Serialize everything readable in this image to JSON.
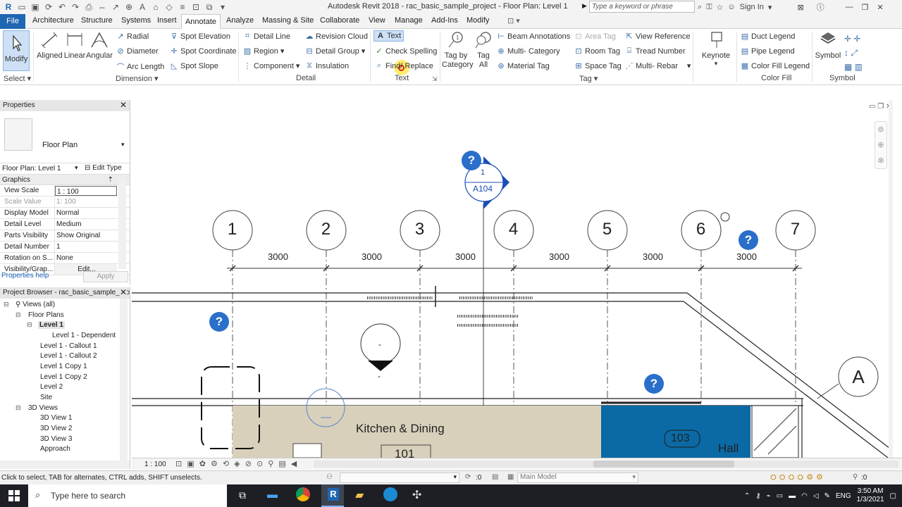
{
  "window": {
    "title": "Autodesk Revit 2018 -    rac_basic_sample_project - Floor Plan: Level 1",
    "search_placeholder": "Type a keyword or phrase",
    "sign_in": "Sign In"
  },
  "tabs": [
    "File",
    "Architecture",
    "Structure",
    "Systems",
    "Insert",
    "Annotate",
    "Analyze",
    "Massing & Site",
    "Collaborate",
    "View",
    "Manage",
    "Add-Ins",
    "Modify"
  ],
  "ribbon": {
    "modify": "Modify",
    "select": "Select",
    "aligned": "Aligned",
    "linear": "Linear",
    "angular": "Angular",
    "radial": "Radial",
    "diameter": "Diameter",
    "arc_length": "Arc Length",
    "spot_elevation": "Spot Elevation",
    "spot_coordinate": "Spot Coordinate",
    "spot_slope": "Spot Slope",
    "dimension": "Dimension",
    "detail_line": "Detail Line",
    "region": "Region",
    "component": "Component",
    "revision_cloud": "Revision Cloud",
    "detail_group": "Detail Group",
    "insulation": "Insulation",
    "detail": "Detail",
    "text_btn": "Text",
    "check_spelling": "Check Spelling",
    "find_replace": "Find/ Replace",
    "text_panel": "Text",
    "tag_by_category": "Tag by Category",
    "tag_all": "Tag All",
    "beam_annotations": "Beam Annotations",
    "multi_category": "Multi- Category",
    "material_tag": "Material Tag",
    "area_tag": "Area Tag",
    "room_tag": "Room Tag",
    "space_tag": "Space Tag",
    "view_reference": "View Reference",
    "tread_number": "Tread Number",
    "multi_rebar": "Multi- Rebar",
    "tag_panel": "Tag",
    "keynote": "Keynote",
    "duct_legend": "Duct Legend",
    "pipe_legend": "Pipe Legend",
    "color_fill_legend": "Color Fill Legend",
    "color_fill_panel": "Color Fill",
    "symbol": "Symbol",
    "symbol_panel": "Symbol"
  },
  "properties": {
    "header": "Properties",
    "type_name": "Floor Plan",
    "selector": "Floor Plan: Level 1",
    "edit_type": "Edit Type",
    "group": "Graphics",
    "rows": [
      {
        "k": "View Scale",
        "v": "1 : 100"
      },
      {
        "k": "Scale Value",
        "v": "1:",
        "v2": "100"
      },
      {
        "k": "Display Model",
        "v": "Normal"
      },
      {
        "k": "Detail Level",
        "v": "Medium"
      },
      {
        "k": "Parts Visibility",
        "v": "Show Original"
      },
      {
        "k": "Detail Number",
        "v": "1"
      },
      {
        "k": "Rotation on S...",
        "v": "None"
      },
      {
        "k": "Visibility/Grap...",
        "v": "Edit..."
      }
    ],
    "help": "Properties help",
    "apply": "Apply"
  },
  "browser": {
    "header": "Project Browser - rac_basic_sample_pro...",
    "nodes": [
      "Views (all)",
      "Floor Plans",
      "Level 1",
      "Level 1 - Dependent",
      "Level 1 - Callout 1",
      "Level 1 - Callout 2",
      "Level 1 Copy 1",
      "Level 1 Copy 2",
      "Level 2",
      "Site",
      "3D Views",
      "3D View 1",
      "3D View 2",
      "3D View 3",
      "Approach"
    ]
  },
  "drawing": {
    "grids": [
      "1",
      "2",
      "3",
      "4",
      "5",
      "6",
      "7"
    ],
    "dims": [
      "3000",
      "3000",
      "3000",
      "3000",
      "3000",
      "3000"
    ],
    "section_num": "1",
    "section_sheet": "A104",
    "grid_a": "A",
    "room1_name": "Kitchen & Dining",
    "room1_num": "101",
    "room2_num": "103",
    "room2_name": "Hall",
    "tag_dash": "-"
  },
  "viewbar": {
    "scale": "1 : 100"
  },
  "status": {
    "message": "Click to select, TAB for alternates, CTRL adds, SHIFT unselects.",
    "zero": ":0",
    "model": "Main Model",
    "filter": ":0"
  },
  "taskbar": {
    "search": "Type here to search",
    "lang": "ENG",
    "time": "3:50 AM",
    "date": "1/3/2021"
  },
  "colors": {
    "accent": "#1f66b3",
    "room_fill": "#d8d0bb",
    "hall_fill": "#0b6aa5",
    "help_bubble": "#2a6fc9"
  }
}
